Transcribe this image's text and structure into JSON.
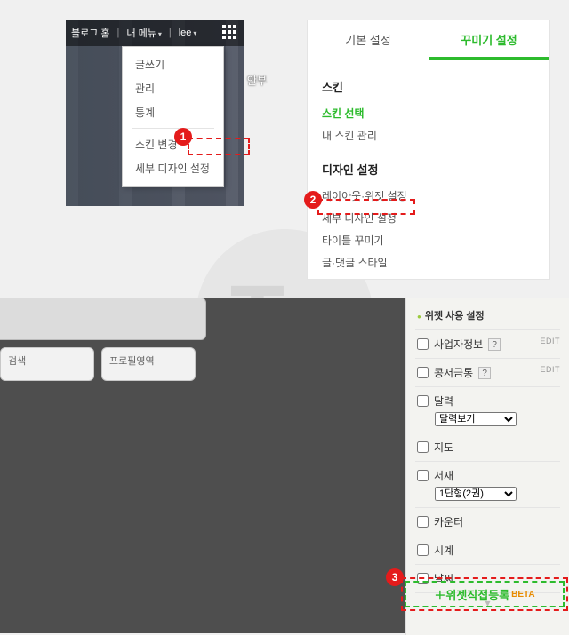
{
  "blog_header": {
    "home": "블로그 홈",
    "my_menu": "내 메뉴",
    "user": "lee",
    "side_label": "안부"
  },
  "dropdown": {
    "write": "글쓰기",
    "manage": "관리",
    "stats": "통계",
    "skin_change": "스킨 변경",
    "detail_design": "세부 디자인 설정"
  },
  "tabs": {
    "basic": "기본 설정",
    "decorate": "꾸미기 설정"
  },
  "skin_section": {
    "heading": "스킨",
    "select": "스킨 선택",
    "my_skin": "내 스킨 관리"
  },
  "design_section": {
    "heading": "디자인 설정",
    "layout_widget": "레이아웃·위젯 설정",
    "detail": "세부 디자인 설정",
    "title_deco": "타이틀 꾸미기",
    "post_style": "글·댓글 스타일"
  },
  "preview": {
    "search": "검색",
    "profile": "프로필영역"
  },
  "widget_bar": {
    "title": "위젯 사용 설정",
    "edit": "EDIT",
    "items": {
      "biz": "사업자정보",
      "piggy": "콩저금통",
      "calendar": "달력",
      "calendar_view": "달력보기",
      "map": "지도",
      "bookshelf": "서재",
      "shelf_layout": "1단형(2권)",
      "counter": "카운터",
      "clock": "시계",
      "weather": "날씨"
    },
    "drop_icon": "▾"
  },
  "direct_widget": {
    "plus": "＋",
    "label": "위젯직접등록",
    "beta": "BETA"
  },
  "badges": {
    "one": "1",
    "two": "2",
    "three": "3"
  }
}
